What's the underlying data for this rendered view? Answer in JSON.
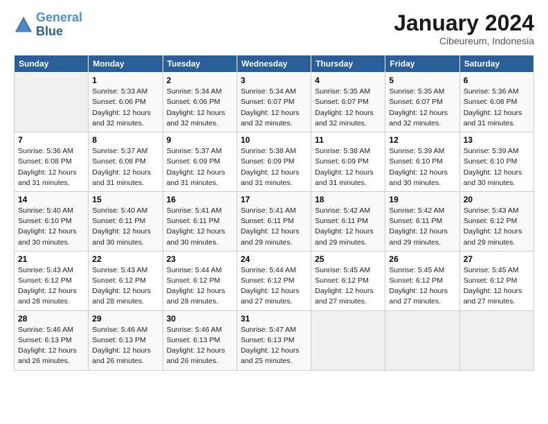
{
  "header": {
    "logo_line1": "General",
    "logo_line2": "Blue",
    "month": "January 2024",
    "location": "Cibeureum, Indonesia"
  },
  "days_of_week": [
    "Sunday",
    "Monday",
    "Tuesday",
    "Wednesday",
    "Thursday",
    "Friday",
    "Saturday"
  ],
  "weeks": [
    [
      {
        "num": "",
        "empty": true
      },
      {
        "num": "1",
        "rise": "5:33 AM",
        "set": "6:06 PM",
        "daylight": "12 hours and 32 minutes."
      },
      {
        "num": "2",
        "rise": "5:34 AM",
        "set": "6:06 PM",
        "daylight": "12 hours and 32 minutes."
      },
      {
        "num": "3",
        "rise": "5:34 AM",
        "set": "6:07 PM",
        "daylight": "12 hours and 32 minutes."
      },
      {
        "num": "4",
        "rise": "5:35 AM",
        "set": "6:07 PM",
        "daylight": "12 hours and 32 minutes."
      },
      {
        "num": "5",
        "rise": "5:35 AM",
        "set": "6:07 PM",
        "daylight": "12 hours and 32 minutes."
      },
      {
        "num": "6",
        "rise": "5:36 AM",
        "set": "6:08 PM",
        "daylight": "12 hours and 31 minutes."
      }
    ],
    [
      {
        "num": "7",
        "rise": "5:36 AM",
        "set": "6:08 PM",
        "daylight": "12 hours and 31 minutes."
      },
      {
        "num": "8",
        "rise": "5:37 AM",
        "set": "6:08 PM",
        "daylight": "12 hours and 31 minutes."
      },
      {
        "num": "9",
        "rise": "5:37 AM",
        "set": "6:09 PM",
        "daylight": "12 hours and 31 minutes."
      },
      {
        "num": "10",
        "rise": "5:38 AM",
        "set": "6:09 PM",
        "daylight": "12 hours and 31 minutes."
      },
      {
        "num": "11",
        "rise": "5:38 AM",
        "set": "6:09 PM",
        "daylight": "12 hours and 31 minutes."
      },
      {
        "num": "12",
        "rise": "5:39 AM",
        "set": "6:10 PM",
        "daylight": "12 hours and 30 minutes."
      },
      {
        "num": "13",
        "rise": "5:39 AM",
        "set": "6:10 PM",
        "daylight": "12 hours and 30 minutes."
      }
    ],
    [
      {
        "num": "14",
        "rise": "5:40 AM",
        "set": "6:10 PM",
        "daylight": "12 hours and 30 minutes."
      },
      {
        "num": "15",
        "rise": "5:40 AM",
        "set": "6:11 PM",
        "daylight": "12 hours and 30 minutes."
      },
      {
        "num": "16",
        "rise": "5:41 AM",
        "set": "6:11 PM",
        "daylight": "12 hours and 30 minutes."
      },
      {
        "num": "17",
        "rise": "5:41 AM",
        "set": "6:11 PM",
        "daylight": "12 hours and 29 minutes."
      },
      {
        "num": "18",
        "rise": "5:42 AM",
        "set": "6:11 PM",
        "daylight": "12 hours and 29 minutes."
      },
      {
        "num": "19",
        "rise": "5:42 AM",
        "set": "6:11 PM",
        "daylight": "12 hours and 29 minutes."
      },
      {
        "num": "20",
        "rise": "5:43 AM",
        "set": "6:12 PM",
        "daylight": "12 hours and 29 minutes."
      }
    ],
    [
      {
        "num": "21",
        "rise": "5:43 AM",
        "set": "6:12 PM",
        "daylight": "12 hours and 28 minutes."
      },
      {
        "num": "22",
        "rise": "5:43 AM",
        "set": "6:12 PM",
        "daylight": "12 hours and 28 minutes."
      },
      {
        "num": "23",
        "rise": "5:44 AM",
        "set": "6:12 PM",
        "daylight": "12 hours and 28 minutes."
      },
      {
        "num": "24",
        "rise": "5:44 AM",
        "set": "6:12 PM",
        "daylight": "12 hours and 27 minutes."
      },
      {
        "num": "25",
        "rise": "5:45 AM",
        "set": "6:12 PM",
        "daylight": "12 hours and 27 minutes."
      },
      {
        "num": "26",
        "rise": "5:45 AM",
        "set": "6:12 PM",
        "daylight": "12 hours and 27 minutes."
      },
      {
        "num": "27",
        "rise": "5:45 AM",
        "set": "6:12 PM",
        "daylight": "12 hours and 27 minutes."
      }
    ],
    [
      {
        "num": "28",
        "rise": "5:46 AM",
        "set": "6:13 PM",
        "daylight": "12 hours and 26 minutes."
      },
      {
        "num": "29",
        "rise": "5:46 AM",
        "set": "6:13 PM",
        "daylight": "12 hours and 26 minutes."
      },
      {
        "num": "30",
        "rise": "5:46 AM",
        "set": "6:13 PM",
        "daylight": "12 hours and 26 minutes."
      },
      {
        "num": "31",
        "rise": "5:47 AM",
        "set": "6:13 PM",
        "daylight": "12 hours and 25 minutes."
      },
      {
        "num": "",
        "empty": true
      },
      {
        "num": "",
        "empty": true
      },
      {
        "num": "",
        "empty": true
      }
    ]
  ],
  "labels": {
    "sunrise": "Sunrise:",
    "sunset": "Sunset:",
    "daylight": "Daylight:"
  }
}
